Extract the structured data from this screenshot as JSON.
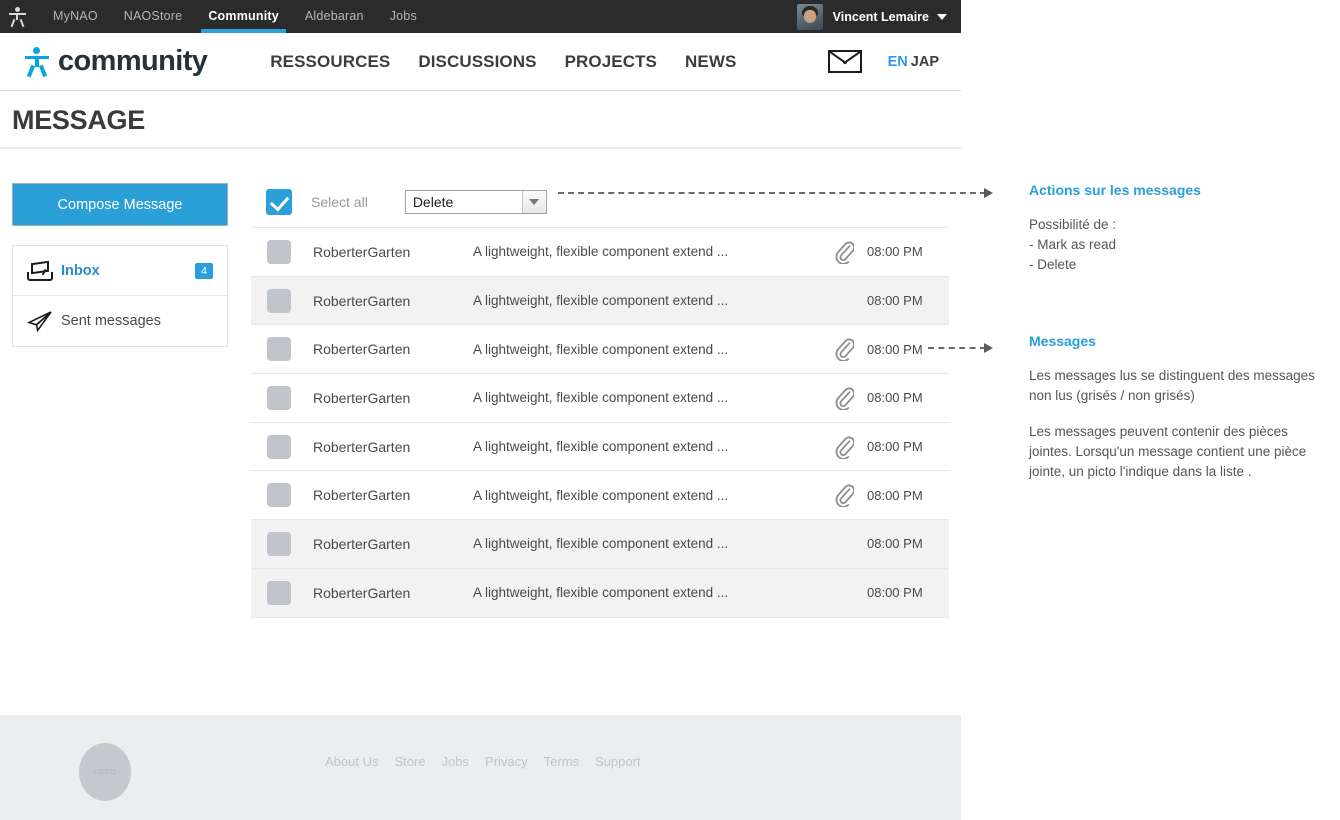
{
  "topbar": {
    "logo_icon": "nao-robot-icon",
    "nav": [
      {
        "label": "MyNAO",
        "active": false
      },
      {
        "label": "NAOStore",
        "active": false
      },
      {
        "label": "Community",
        "active": true
      },
      {
        "label": "Aldebaran",
        "active": false
      },
      {
        "label": "Jobs",
        "active": false
      }
    ],
    "user": {
      "name": "Vincent Lemaire",
      "avatar_icon": "user-avatar",
      "caret_icon": "chevron-down-icon"
    }
  },
  "mainnav": {
    "brand": "community",
    "brand_icon": "community-robot-icon",
    "links": [
      "RESSOURCES",
      "DISCUSSIONS",
      "PROJECTS",
      "NEWS"
    ],
    "mail_icon": "envelope-icon",
    "lang_active": "EN",
    "lang_inactive": "JAP",
    "accent_color": "#2a9fd8"
  },
  "page": {
    "title": "MESSAGE"
  },
  "sidebar": {
    "compose_label": "Compose Message",
    "folders": [
      {
        "label": "Inbox",
        "icon": "inbox-icon",
        "badge": "4",
        "active": true
      },
      {
        "label": "Sent messages",
        "icon": "paper-plane-icon",
        "badge": "",
        "active": false
      }
    ]
  },
  "toolbar": {
    "select_all_label": "Select all",
    "select_all_checked": true,
    "action_value": "Delete",
    "action_options": [
      "Delete",
      "Mark as read"
    ]
  },
  "messages": {
    "columns": [
      "select",
      "sender",
      "subject",
      "attachment",
      "time"
    ],
    "rows": [
      {
        "sender": "RoberterGarten",
        "subject": "A lightweight, flexible component extend ...",
        "time": "08:00 PM",
        "attachment": true,
        "read": false
      },
      {
        "sender": "RoberterGarten",
        "subject": "A lightweight, flexible component extend ...",
        "time": "08:00 PM",
        "attachment": false,
        "read": true
      },
      {
        "sender": "RoberterGarten",
        "subject": "A lightweight, flexible component extend ...",
        "time": "08:00 PM",
        "attachment": true,
        "read": false
      },
      {
        "sender": "RoberterGarten",
        "subject": "A lightweight, flexible component extend ...",
        "time": "08:00 PM",
        "attachment": true,
        "read": false
      },
      {
        "sender": "RoberterGarten",
        "subject": "A lightweight, flexible component extend ...",
        "time": "08:00 PM",
        "attachment": true,
        "read": false
      },
      {
        "sender": "RoberterGarten",
        "subject": "A lightweight, flexible component extend ...",
        "time": "08:00 PM",
        "attachment": true,
        "read": false
      },
      {
        "sender": "RoberterGarten",
        "subject": "A lightweight, flexible component extend ...",
        "time": "08:00 PM",
        "attachment": false,
        "read": true
      },
      {
        "sender": "RoberterGarten",
        "subject": "A lightweight, flexible component extend ...",
        "time": "08:00 PM",
        "attachment": false,
        "read": true
      }
    ]
  },
  "annotations": [
    {
      "title": "Actions sur les messages",
      "body": "Possibilité de :\n- Mark as read\n- Delete"
    },
    {
      "title": "Messages",
      "body": "Les messages lus se distinguent des messages non lus (grisés / non grisés)",
      "body2": "Les messages peuvent contenir des pièces jointes.  Lorsqu'un message contient une pièce jointe, un picto l'indique dans la liste ."
    }
  ],
  "footer": {
    "logo_text": "LOGO",
    "links": [
      "About Us",
      "Store",
      "Jobs",
      "Privacy",
      "Terms",
      "Support"
    ]
  }
}
